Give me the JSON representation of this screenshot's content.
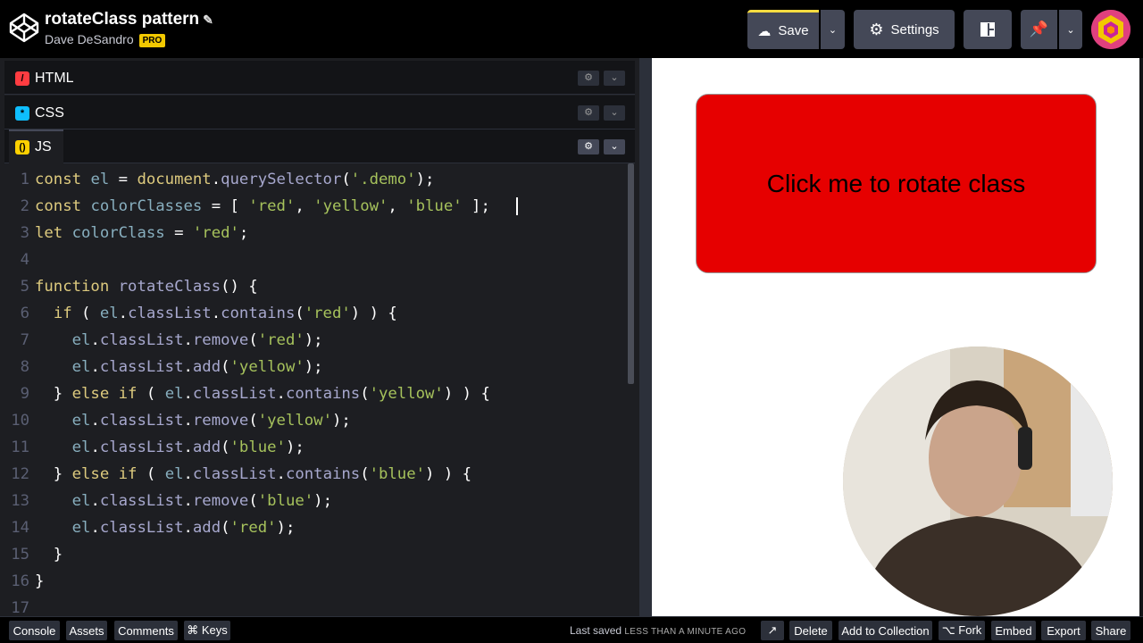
{
  "header": {
    "title": "rotateClass pattern",
    "author": "Dave DeSandro",
    "pro_badge": "PRO",
    "save_label": "Save",
    "settings_label": "Settings"
  },
  "panels": {
    "html": "HTML",
    "css": "CSS",
    "js": "JS"
  },
  "code_lines": [
    {
      "n": "1",
      "html": "<span class=\"k\">const</span> <span class=\"v\">el</span> = <span class=\"k\">document</span>.<span class=\"f\">querySelector</span>(<span class=\"s\">'.demo'</span>);"
    },
    {
      "n": "2",
      "html": "<span class=\"k\">const</span> <span class=\"v\">colorClasses</span> = [ <span class=\"s\">'red'</span>, <span class=\"s\">'yellow'</span>, <span class=\"s\">'blue'</span> ];"
    },
    {
      "n": "3",
      "html": "<span class=\"k\">let</span> <span class=\"v\">colorClass</span> = <span class=\"s\">'red'</span>;"
    },
    {
      "n": "4",
      "html": ""
    },
    {
      "n": "5",
      "html": "<span class=\"k\">function</span> <span class=\"f\">rotateClass</span>() {"
    },
    {
      "n": "6",
      "html": "  <span class=\"k\">if</span> ( <span class=\"v\">el</span>.<span class=\"f\">classList</span>.<span class=\"f\">contains</span>(<span class=\"s\">'red'</span>) ) {"
    },
    {
      "n": "7",
      "html": "    <span class=\"v\">el</span>.<span class=\"f\">classList</span>.<span class=\"f\">remove</span>(<span class=\"s\">'red'</span>);"
    },
    {
      "n": "8",
      "html": "    <span class=\"v\">el</span>.<span class=\"f\">classList</span>.<span class=\"f\">add</span>(<span class=\"s\">'yellow'</span>);"
    },
    {
      "n": "9",
      "html": "  } <span class=\"k\">else if</span> ( <span class=\"v\">el</span>.<span class=\"f\">classList</span>.<span class=\"f\">contains</span>(<span class=\"s\">'yellow'</span>) ) {"
    },
    {
      "n": "10",
      "html": "    <span class=\"v\">el</span>.<span class=\"f\">classList</span>.<span class=\"f\">remove</span>(<span class=\"s\">'yellow'</span>);"
    },
    {
      "n": "11",
      "html": "    <span class=\"v\">el</span>.<span class=\"f\">classList</span>.<span class=\"f\">add</span>(<span class=\"s\">'blue'</span>);"
    },
    {
      "n": "12",
      "html": "  } <span class=\"k\">else if</span> ( <span class=\"v\">el</span>.<span class=\"f\">classList</span>.<span class=\"f\">contains</span>(<span class=\"s\">'blue'</span>) ) {"
    },
    {
      "n": "13",
      "html": "    <span class=\"v\">el</span>.<span class=\"f\">classList</span>.<span class=\"f\">remove</span>(<span class=\"s\">'blue'</span>);"
    },
    {
      "n": "14",
      "html": "    <span class=\"v\">el</span>.<span class=\"f\">classList</span>.<span class=\"f\">add</span>(<span class=\"s\">'red'</span>);"
    },
    {
      "n": "15",
      "html": "  }"
    },
    {
      "n": "16",
      "html": "}"
    },
    {
      "n": "17",
      "html": ""
    }
  ],
  "preview": {
    "button_label": "Click me to rotate class",
    "button_color": "#e60000"
  },
  "footer": {
    "console": "Console",
    "assets": "Assets",
    "comments": "Comments",
    "keys": "⌘ Keys",
    "last_saved": "Last saved",
    "last_saved_time": "LESS THAN A MINUTE AGO",
    "delete": "Delete",
    "add_to_collection": "Add to Collection",
    "fork": "⌥ Fork",
    "embed": "Embed",
    "export": "Export",
    "share": "Share"
  },
  "colors": {
    "accent_save": "#ffdd40",
    "html_icon": "#ff3c41",
    "css_icon": "#0ebeff",
    "js_icon": "#fcd000"
  }
}
